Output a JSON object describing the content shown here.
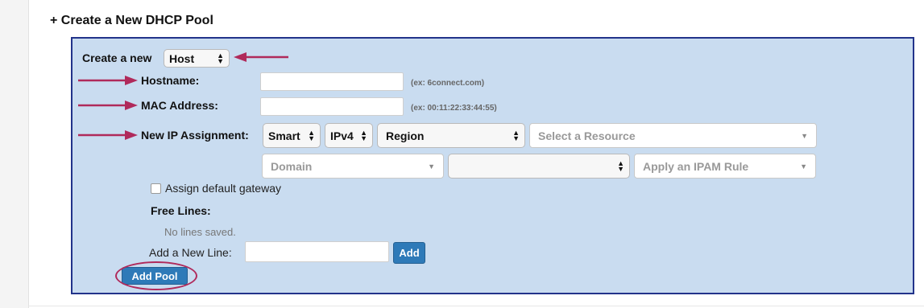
{
  "section": {
    "title": "+ Create a New DHCP Pool"
  },
  "form": {
    "create_new_label": "Create a new",
    "type_select": "Host",
    "hostname_label": "Hostname:",
    "hostname_value": "",
    "hostname_hint": "(ex: 6connect.com)",
    "mac_label": "MAC Address:",
    "mac_value": "",
    "mac_hint": "(ex: 00:11:22:33:44:55)",
    "ip_label": "New IP Assignment:",
    "mode_select": "Smart",
    "version_select": "IPv4",
    "scope_select": "Region",
    "resource_placeholder": "Select a Resource",
    "domain_placeholder": "Domain",
    "blank_select": "",
    "ipam_rule_placeholder": "Apply an IPAM Rule",
    "gateway_label": "Assign default gateway",
    "gateway_checked": false,
    "free_lines_label": "Free Lines:",
    "no_lines_text": "No lines saved.",
    "add_line_label": "Add a New Line:",
    "add_line_value": "",
    "add_button": "Add",
    "add_pool_button": "Add Pool"
  },
  "annotation": {
    "arrow_color": "#b02a5b"
  }
}
